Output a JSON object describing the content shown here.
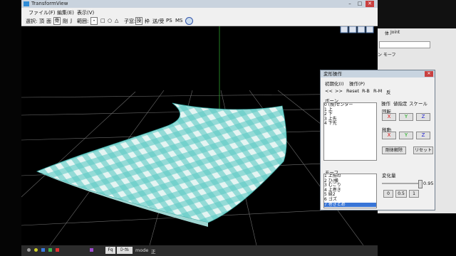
{
  "window": {
    "title": "TransformView"
  },
  "menu": [
    "ファイル(F)",
    "編集(E)",
    "表示(V)"
  ],
  "toolbar": {
    "select_label": "選択:",
    "select_items": [
      "頂",
      "面",
      "骨",
      "剛",
      "J"
    ],
    "range_label": "範囲:",
    "range_items": [
      "・",
      "□",
      "○",
      "△"
    ],
    "child_label": "子窓:",
    "child_items": [
      "操",
      "枠",
      "送/受",
      "PS",
      "MS"
    ]
  },
  "dialog": {
    "title": "変形操作",
    "menu": [
      "初期化(I)",
      "操作(P)"
    ],
    "nav": [
      "<<",
      ">>",
      "Reset",
      "R-B",
      "R-M",
      "反"
    ],
    "bone_label": "ボーン",
    "bones": [
      "0  (親)センター",
      "1  上",
      "2  下",
      "3  上先",
      "4  下先"
    ],
    "tabs": [
      "操作",
      "値指定",
      "スケール"
    ],
    "rotation_label": "回転",
    "move_label": "移動",
    "axes": [
      "X",
      "Y",
      "Z"
    ],
    "reset_buttons": [
      "剛体解除",
      "リセット"
    ],
    "morph_label": "モーフ",
    "morphs": [
      "1  上揃の",
      "2  ひ/横",
      "3  むごり",
      "4  上巻き",
      "5  縁2",
      "6  ゴズ",
      "7  巻きとめ"
    ],
    "selected_morph": "7  巻きとめ",
    "variation_label": "変化量",
    "variation_value": "0.95",
    "variation_level": 0.95,
    "preset_buttons": [
      "0",
      "0.5",
      "1"
    ]
  },
  "bgwin": {
    "tabs": [
      "体",
      "Joint"
    ],
    "label1": "ン モーフ"
  },
  "statusbar": {
    "mode_label": "mode",
    "mode_value": "正",
    "items": [
      "Fq",
      "ﾛｰｶﾙ"
    ]
  },
  "colors": {
    "cloth_main": "#5fc9c5",
    "cloth_light": "#e4f4f2",
    "grid": "#777777"
  }
}
